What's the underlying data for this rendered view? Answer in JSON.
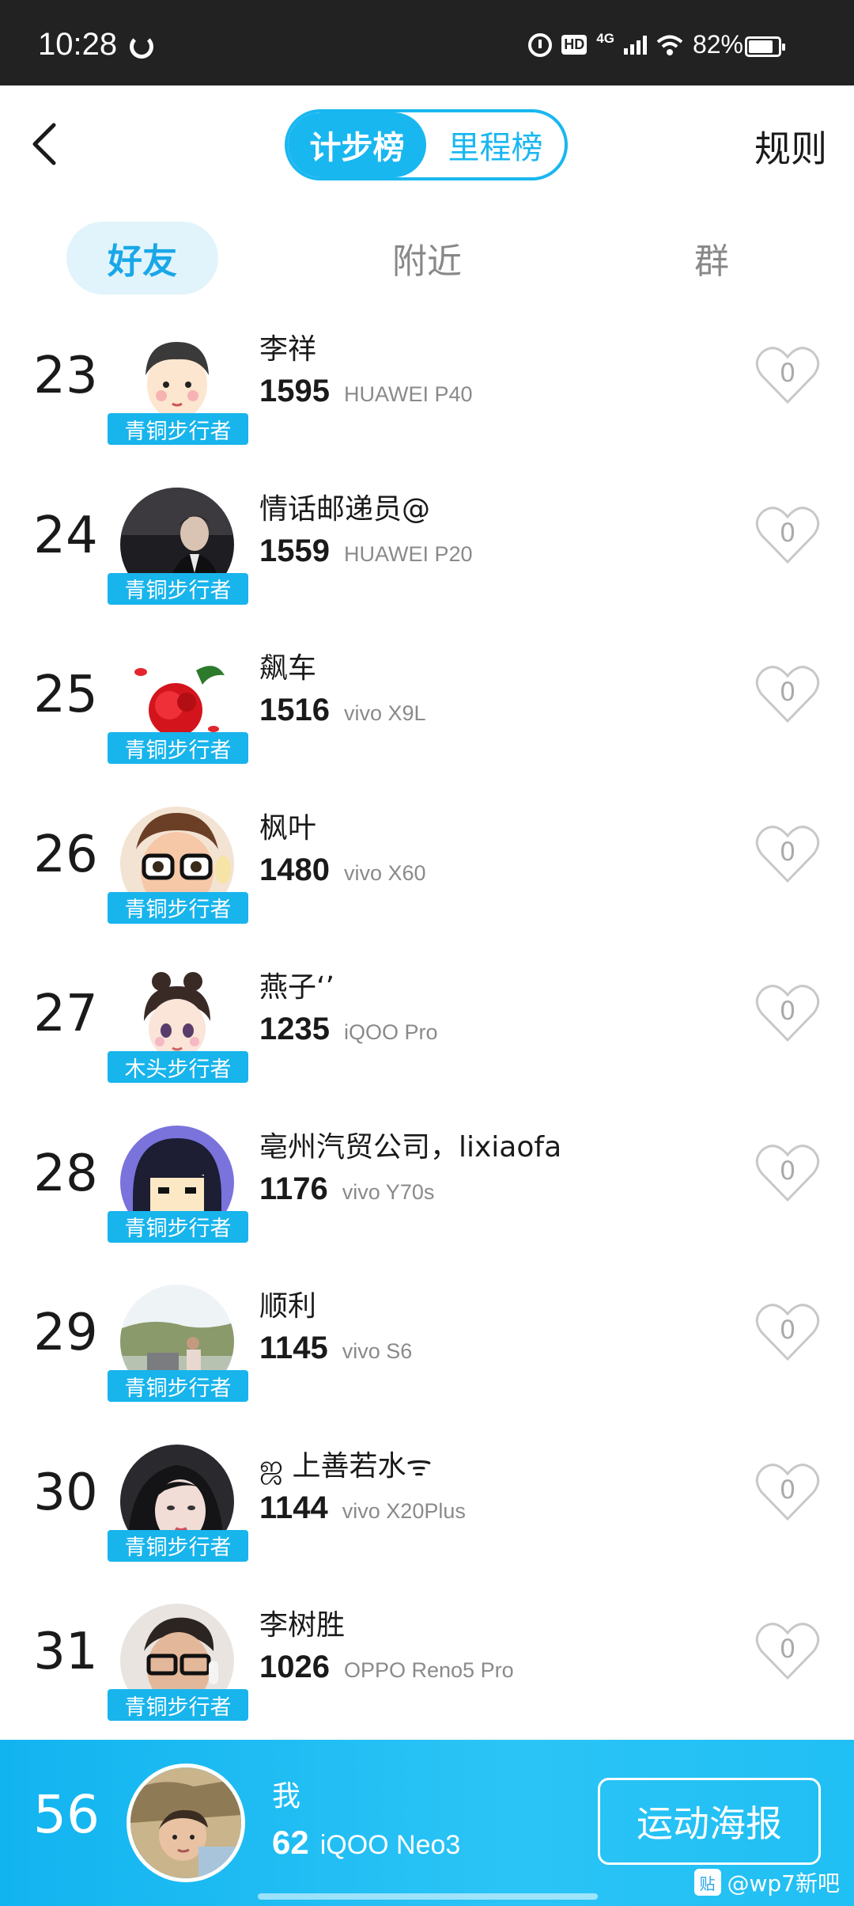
{
  "status_bar": {
    "time": "10:28",
    "hd": "HD",
    "network": "4G",
    "battery_text": "82%",
    "battery_level": 0.82
  },
  "header": {
    "back_icon": "chevron-left-icon",
    "tabs": [
      {
        "label": "计步榜",
        "active": true
      },
      {
        "label": "里程榜",
        "active": false
      }
    ],
    "rules_label": "规则"
  },
  "subtabs": [
    {
      "label": "好友",
      "active": true
    },
    {
      "label": "附近",
      "active": false
    },
    {
      "label": "群",
      "active": false
    }
  ],
  "ranking": [
    {
      "rank": "23",
      "name": "李祥",
      "steps": "1595",
      "device": "HUAWEI P40",
      "badge": "青铜步行者",
      "likes": "0"
    },
    {
      "rank": "24",
      "name": "情话邮递员@",
      "steps": "1559",
      "device": "HUAWEI P20",
      "badge": "青铜步行者",
      "likes": "0"
    },
    {
      "rank": "25",
      "name": "飙车",
      "steps": "1516",
      "device": "vivo X9L",
      "badge": "青铜步行者",
      "likes": "0"
    },
    {
      "rank": "26",
      "name": "枫叶",
      "steps": "1480",
      "device": "vivo X60",
      "badge": "青铜步行者",
      "likes": "0"
    },
    {
      "rank": "27",
      "name": "燕子‘’",
      "steps": "1235",
      "device": "iQOO Pro",
      "badge": "木头步行者",
      "likes": "0"
    },
    {
      "rank": "28",
      "name": "亳州汽贸公司，lixiaofa",
      "steps": "1176",
      "device": "vivo Y70s",
      "badge": "青铜步行者",
      "likes": "0"
    },
    {
      "rank": "29",
      "name": "顺利",
      "steps": "1145",
      "device": "vivo S6",
      "badge": "青铜步行者",
      "likes": "0"
    },
    {
      "rank": "30",
      "name": "ஜ  上善若水ᯤ",
      "steps": "1144",
      "device": "vivo X20Plus",
      "badge": "青铜步行者",
      "likes": "0"
    },
    {
      "rank": "31",
      "name": "李树胜",
      "steps": "1026",
      "device": "OPPO Reno5 Pro",
      "badge": "青铜步行者",
      "likes": "0"
    }
  ],
  "me": {
    "rank": "56",
    "name": "我",
    "steps": "62",
    "device": "iQOO Neo3",
    "poster_label": "运动海报"
  },
  "watermark": {
    "logo": "贴",
    "text": "@wp7新吧"
  },
  "colors": {
    "accent": "#19b7f0",
    "badge": "#18b4ec",
    "footer": "#12b4f0"
  }
}
